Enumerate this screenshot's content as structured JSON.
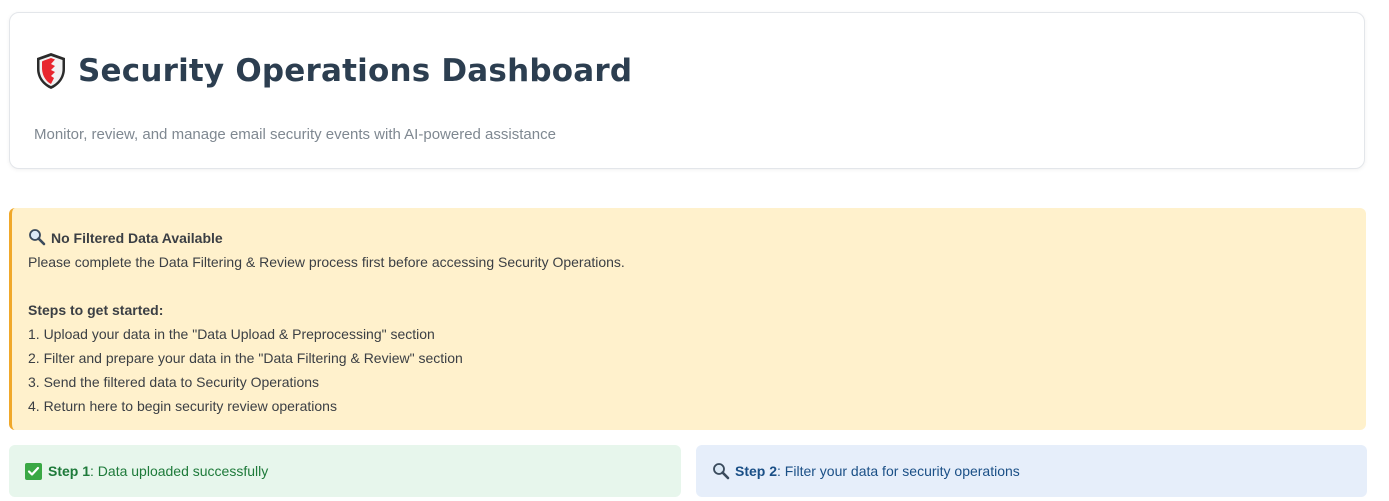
{
  "header": {
    "icon": "shield-icon",
    "title": "Security Operations Dashboard",
    "subtitle": "Monitor, review, and manage email security events with AI-powered assistance"
  },
  "warning": {
    "icon": "magnifier-icon",
    "title": "No Filtered Data Available",
    "message": "Please complete the Data Filtering & Review process first before accessing Security Operations.",
    "steps_heading": "Steps to get started:",
    "steps": [
      "1. Upload your data in the \"Data Upload & Preprocessing\" section",
      "2. Filter and prepare your data in the \"Data Filtering & Review\" section",
      "3. Send the filtered data to Security Operations",
      "4. Return here to begin security review operations"
    ],
    "accent_color": "#f0a82a",
    "background_color": "#fff1cc"
  },
  "status": {
    "step1": {
      "icon": "checkmark-icon",
      "label": "Step 1",
      "text": ": Data uploaded successfully",
      "color": "#1e7a3a"
    },
    "step2": {
      "icon": "magnifier-icon",
      "label": "Step 2",
      "text": ": Filter your data for security operations",
      "color": "#1a4f86"
    }
  }
}
